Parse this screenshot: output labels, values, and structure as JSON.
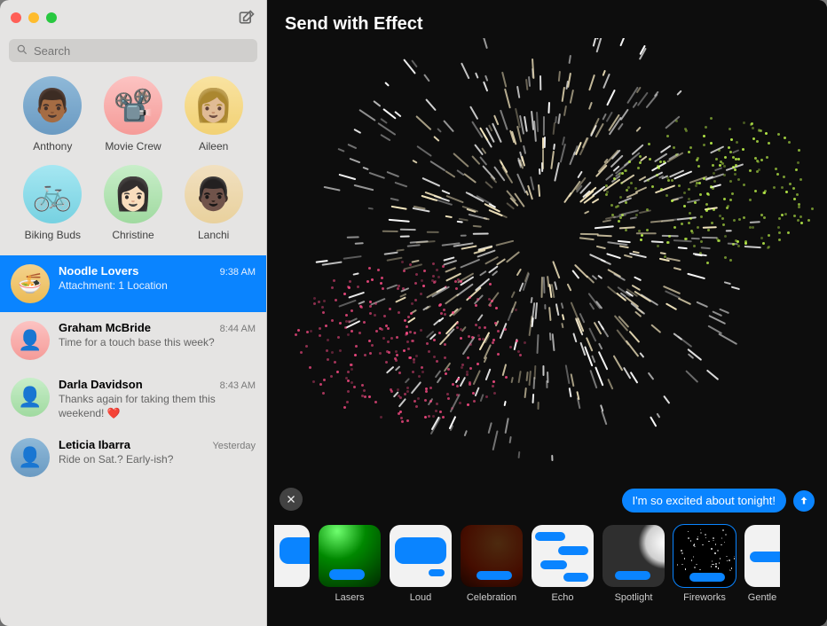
{
  "search": {
    "placeholder": "Search"
  },
  "header": {
    "effect_title": "Send with Effect"
  },
  "message": {
    "text": "I'm so excited about tonight!"
  },
  "pinned": [
    {
      "label": "Anthony",
      "avatar_class": "av-blue"
    },
    {
      "label": "Movie Crew",
      "avatar_class": "av-pink"
    },
    {
      "label": "Aileen",
      "avatar_class": "av-yellow"
    },
    {
      "label": "Biking Buds",
      "avatar_class": "av-cyan"
    },
    {
      "label": "Christine",
      "avatar_class": "av-green"
    },
    {
      "label": "Lanchi",
      "avatar_class": "av-cream"
    }
  ],
  "conversations": [
    {
      "name": "Noodle Lovers",
      "time": "9:38 AM",
      "preview": "Attachment: 1 Location",
      "selected": true,
      "avatar_class": "av-gold",
      "emoji": "🍜"
    },
    {
      "name": "Graham McBride",
      "time": "8:44 AM",
      "preview": "Time for a touch base this week?",
      "selected": false,
      "avatar_class": "av-pink",
      "emoji": ""
    },
    {
      "name": "Darla Davidson",
      "time": "8:43 AM",
      "preview": "Thanks again for taking them this weekend! ❤️",
      "selected": false,
      "avatar_class": "av-green",
      "emoji": ""
    },
    {
      "name": "Leticia Ibarra",
      "time": "Yesterday",
      "preview": "Ride on Sat.? Early-ish?",
      "selected": false,
      "avatar_class": "av-blue",
      "emoji": ""
    }
  ],
  "effects": [
    {
      "label": "",
      "type": "partial-left",
      "kind": "loud"
    },
    {
      "label": "Lasers",
      "type": "full",
      "kind": "lasers"
    },
    {
      "label": "Loud",
      "type": "full",
      "kind": "loud"
    },
    {
      "label": "Celebration",
      "type": "full",
      "kind": "celebration"
    },
    {
      "label": "Echo",
      "type": "full",
      "kind": "echo"
    },
    {
      "label": "Spotlight",
      "type": "full",
      "kind": "spotlight"
    },
    {
      "label": "Fireworks",
      "type": "full",
      "kind": "fireworks",
      "selected": true
    },
    {
      "label": "Gentle",
      "type": "partial-right",
      "kind": "gentle"
    }
  ],
  "colors": {
    "accent": "#0a84ff"
  }
}
